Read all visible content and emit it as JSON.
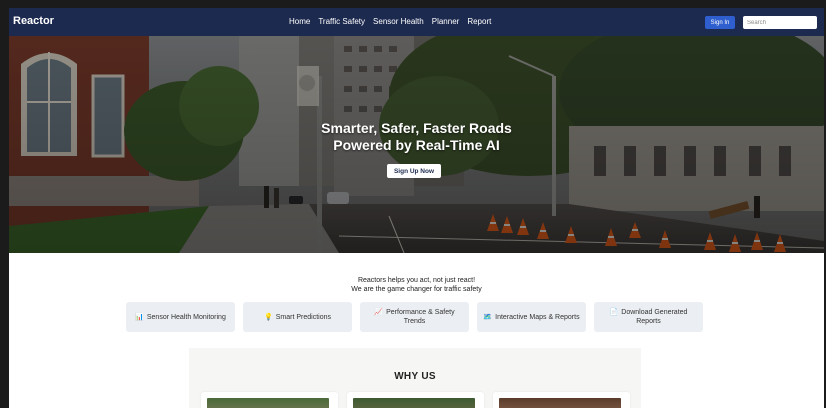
{
  "navbar": {
    "brand": "Reactor",
    "links": [
      "Home",
      "Traffic Safety",
      "Sensor Health",
      "Planner",
      "Report"
    ],
    "signin_label": "Sign In",
    "search_placeholder": "Search"
  },
  "hero": {
    "title_line1": "Smarter, Safer, Faster Roads",
    "title_line2": "Powered by Real-Time AI",
    "cta_label": "Sign Up Now"
  },
  "intro": {
    "line1": "Reactors helps you act, not just react!",
    "line2": "We are the game changer for traffic safety"
  },
  "features": [
    {
      "icon": "📊",
      "label": "Sensor Health Monitoring"
    },
    {
      "icon": "💡",
      "label": "Smart Predictions"
    },
    {
      "icon": "📈",
      "label": "Performance & Safety Trends"
    },
    {
      "icon": "🗺️",
      "label": "Interactive Maps & Reports"
    },
    {
      "icon": "📄",
      "label": "Download Generated Reports"
    }
  ],
  "why_us": {
    "title": "WHY US"
  },
  "colors": {
    "navbar_bg": "#1d2a4f",
    "accent": "#2f5fcf",
    "cone_orange": "#e8601c"
  }
}
